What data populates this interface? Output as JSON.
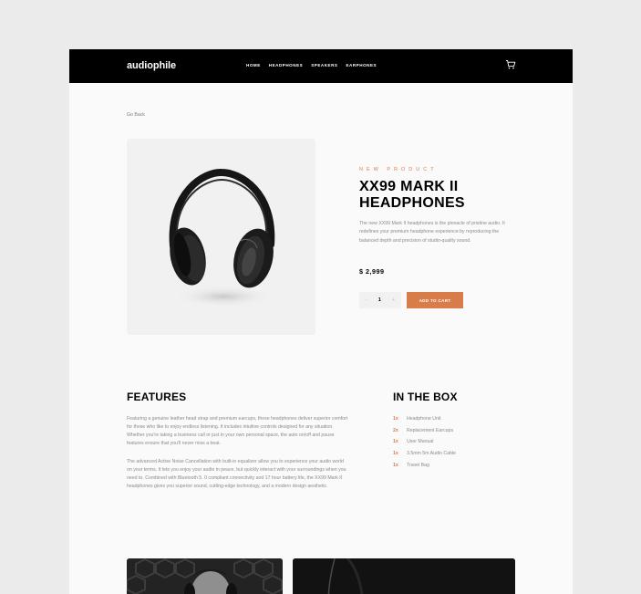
{
  "header": {
    "logo": "audiophile",
    "nav": [
      "HOME",
      "HEADPHONES",
      "SPEAKERS",
      "EARPHONES"
    ],
    "cart_icon": "cart-icon"
  },
  "go_back": "Go Back",
  "product": {
    "overline": "NEW PRODUCT",
    "title_line1": "XX99 MARK II",
    "title_line2": "HEADPHONES",
    "description": "The new XX99 Mark II headphones is the pinnacle of pristine audio. It redefines your premium headphone experience by reproducing the balanced depth and precision of studio-quality sound.",
    "price": "$ 2,999",
    "quantity": {
      "minus": "-",
      "value": "1",
      "plus": "+"
    },
    "add_to_cart": "ADD TO CART"
  },
  "features": {
    "title": "FEATURES",
    "p1": "Featuring a genuine leather head strap and premium earcups, these headphones deliver superior comfort for those who like to enjoy endless listening. It includes intuitive controls designed for any situation. Whether you're taking a business call or just in your own personal space, the auto on/off and pause features ensure that you'll never miss a beat.",
    "p2": "The advanced Active Noise Cancellation with built-in equalizer allow you to experience your audio world on your terms. It lets you enjoy your audio in peace, but quickly interact with your surroundings when you need to. Combined with Bluetooth 5. 0 compliant connectivity and 17 hour battery life, the XX99 Mark II headphones gives you superior sound, cutting-edge technology, and a modern design aesthetic."
  },
  "in_the_box": {
    "title": "IN THE BOX",
    "items": [
      {
        "qty": "1x",
        "name": "Headphone Unit"
      },
      {
        "qty": "2x",
        "name": "Replacement Earcups"
      },
      {
        "qty": "1x",
        "name": "User Manual"
      },
      {
        "qty": "1x",
        "name": "3.5mm 5m Audio Cable"
      },
      {
        "qty": "1x",
        "name": "Travel Bag"
      }
    ]
  },
  "colors": {
    "accent": "#d87d4a",
    "header_bg": "#000000",
    "page_bg": "#fafafa",
    "image_bg": "#f1f1f1"
  }
}
